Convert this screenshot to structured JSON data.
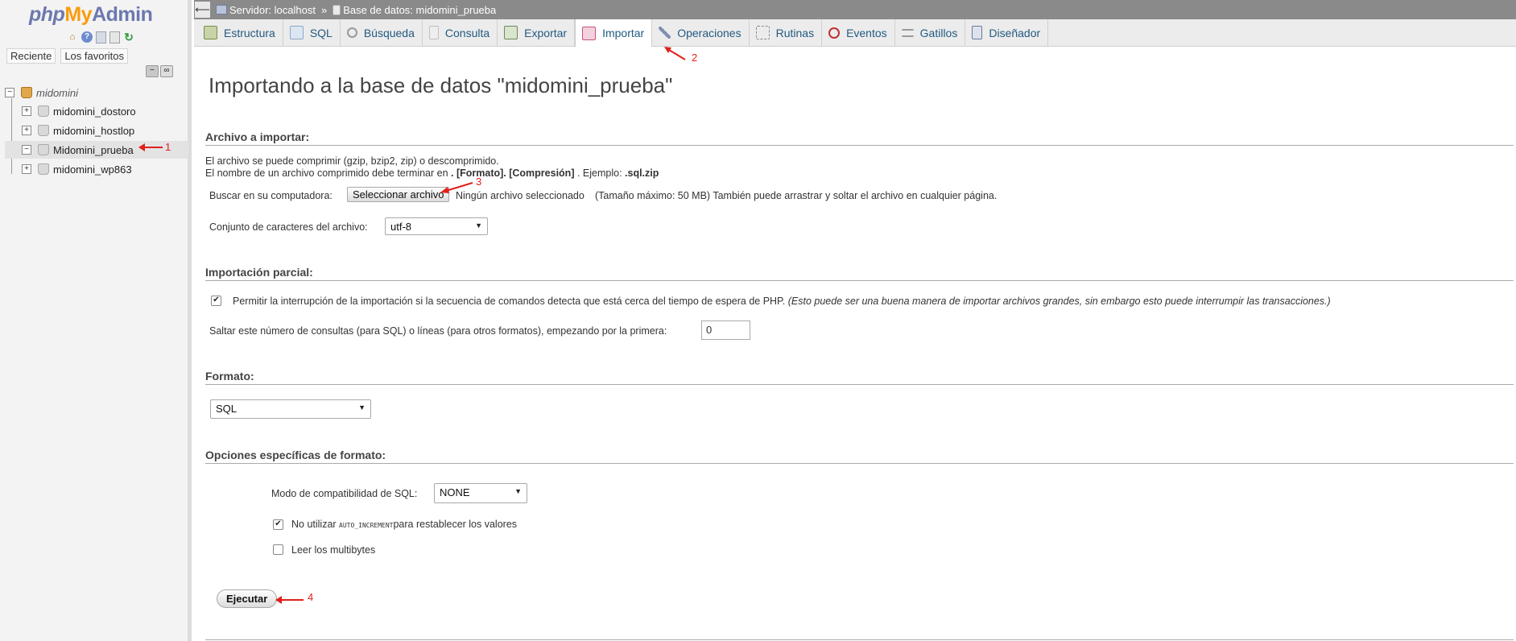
{
  "sidebar": {
    "logo": {
      "php": "php",
      "my": "My",
      "admin": "Admin"
    },
    "icons": [
      "home-icon",
      "help-icon",
      "docs-icon",
      "copy-icon",
      "reload-icon"
    ],
    "tabs": [
      {
        "label": "Reciente"
      },
      {
        "label": "Los favoritos"
      }
    ],
    "tree": {
      "root": "midomini",
      "items": [
        {
          "label": "midomini_dostoro",
          "active": false
        },
        {
          "label": "midomini_hostlop",
          "active": false
        },
        {
          "label": "Midomini_prueba",
          "active": true
        },
        {
          "label": "midomini_wp863",
          "active": false
        }
      ]
    }
  },
  "breadcrumb": {
    "server": "Servidor: localhost",
    "separator": "»",
    "database": "Base de datos: midomini_prueba"
  },
  "tabs": [
    {
      "label": "Estructura",
      "icon": "structure-icon",
      "color": "#7a8c4a"
    },
    {
      "label": "SQL",
      "icon": "sql-icon",
      "color": "#8fa6c9"
    },
    {
      "label": "Búsqueda",
      "icon": "search-icon",
      "color": "#9a9a9a"
    },
    {
      "label": "Consulta",
      "icon": "query-icon",
      "color": "#c0c0c0"
    },
    {
      "label": "Exportar",
      "icon": "export-icon",
      "color": "#6b8a5a"
    },
    {
      "label": "Importar",
      "icon": "import-icon",
      "color": "#c9507a",
      "active": true
    },
    {
      "label": "Operaciones",
      "icon": "wrench-icon",
      "color": "#8090b0"
    },
    {
      "label": "Rutinas",
      "icon": "routines-icon",
      "color": "#8a8a8a"
    },
    {
      "label": "Eventos",
      "icon": "clock-icon",
      "color": "#c03030"
    },
    {
      "label": "Gatillos",
      "icon": "triggers-icon",
      "color": "#9a9a9a"
    },
    {
      "label": "Diseñador",
      "icon": "designer-icon",
      "color": "#6a7a9a"
    }
  ],
  "main": {
    "title": "Importando a la base de datos \"midomini_prueba\"",
    "file_section": {
      "title": "Archivo a importar:",
      "line1": "El archivo se puede comprimir (gzip, bzip2, zip) o descomprimido.",
      "line2_pre": "El nombre de un archivo comprimido debe terminar en ",
      "line2_bold": ". [Formato]. [Compresión]",
      "line2_mid": " . Ejemplo: ",
      "line2_example": ".sql.zip",
      "browse_label": "Buscar en su computadora:",
      "browse_button": "Seleccionar archivo",
      "browse_status": "Ningún archivo seleccionado",
      "max_size": "(Tamaño máximo: 50 MB) También puede arrastrar y soltar el archivo en cualquier página.",
      "charset_label": "Conjunto de caracteres del archivo:",
      "charset_value": "utf-8"
    },
    "partial_section": {
      "title": "Importación parcial:",
      "allow_interrupt_checked": true,
      "allow_interrupt_label": "Permitir la interrupción de la importación si la secuencia de comandos detecta que está cerca del tiempo de espera de PHP.",
      "allow_interrupt_note": "(Esto puede ser una buena manera de importar archivos grandes, sin embargo esto puede interrumpir las transacciones.)",
      "skip_label": "Saltar este número de consultas (para SQL) o líneas (para otros formatos), empezando por la primera:",
      "skip_value": "0"
    },
    "format_section": {
      "title": "Formato:",
      "format_value": "SQL"
    },
    "options_section": {
      "title": "Opciones específicas de formato:",
      "compat_label": "Modo de compatibilidad de SQL:",
      "compat_value": "NONE",
      "no_auto_pre": "No utilizar ",
      "no_auto_code": "AUTO_INCREMENT",
      "no_auto_post": "para restablecer los valores",
      "no_auto_checked": true,
      "multibyte_label": "Leer los multibytes",
      "multibyte_checked": false
    },
    "submit_button": "Ejecutar"
  },
  "annotations": [
    "1",
    "2",
    "3",
    "4"
  ],
  "colors": {
    "annotation": "#e0201b",
    "link": "#235a81",
    "topbar": "#8a8a8a"
  }
}
